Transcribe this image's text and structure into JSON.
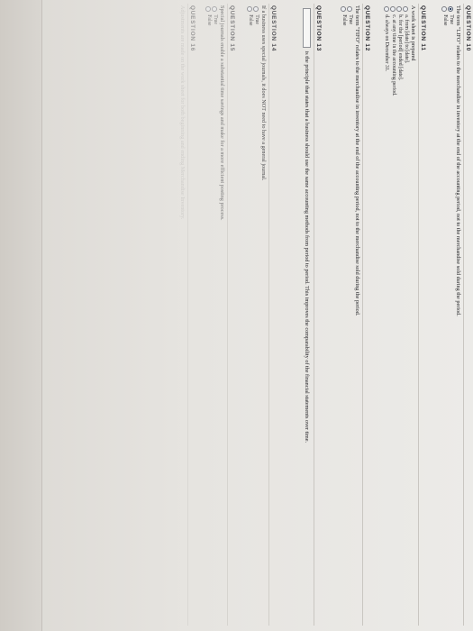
{
  "questions": [
    {
      "number": "QUESTION 10",
      "text": "The term \"LIFO\" relates to the merchandise in inventory at the end of the accounting period, not to the merchandise sold during the period.",
      "options": [
        "True",
        "False"
      ]
    },
    {
      "number": "QUESTION 11",
      "text": "A work sheet is prepared",
      "options": [
        "a. from [date] to [date].",
        "b. for the [period] ended [date].",
        "c. at any time in the accounting period.",
        "d. always on December 31."
      ]
    },
    {
      "number": "QUESTION 12",
      "text": "The term \"FIFO\" relates to the merchandise in inventory at the end of the accounting period, not to the merchandise sold during the period.",
      "options": [
        "True",
        "False"
      ]
    },
    {
      "number": "QUESTION 13",
      "text": "is the principle that states that a business should use the same accounting methods from period to period. This improves the comparability of the financial statements over time."
    },
    {
      "number": "QUESTION 14",
      "text": "If a business uses special journals, it does NOT need to have a general journal.",
      "options": [
        "True",
        "False"
      ]
    },
    {
      "number": "QUESTION 15",
      "text": "Special journals enable a substantial time savings and make for a more efficient posting process.",
      "options": [
        "True",
        "False"
      ]
    },
    {
      "number": "QUESTION 16",
      "text": "Adjustments are made on the work sheet for both beginning and ending Merchandise Inventory."
    }
  ]
}
